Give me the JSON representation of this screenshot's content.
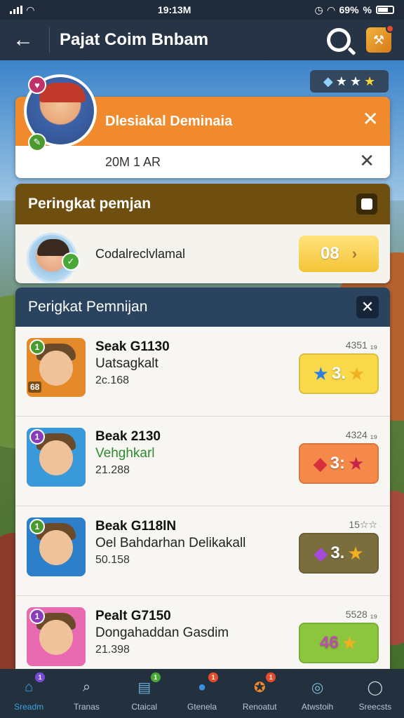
{
  "status_bar": {
    "time": "19:13M",
    "battery": "69%",
    "extra": "%"
  },
  "app_bar": {
    "back_icon": "arrow-left-icon",
    "title": "Pajat Coim Bnbam",
    "search_icon": "search-icon",
    "app_icon": "game-app-icon"
  },
  "rating": {
    "stars_filled": 3,
    "icons": [
      "gem-icon",
      "star-icon",
      "star-icon",
      "star-icon"
    ]
  },
  "notification": {
    "title": "Dlesiakal Deminaia",
    "subtitle": "20M 1 AR"
  },
  "ranking_card": {
    "header": "Peringkat pemjan",
    "name": "Codalreclvlamal",
    "button_value": "08"
  },
  "list_panel": {
    "header": "Perigkat Pemnijan",
    "items": [
      {
        "title": "Seak G1130",
        "subtitle": "Uatsagkalt",
        "value": "2c.168",
        "meta": "4351 ₁₉",
        "badge_num": "1",
        "thumb_level": "68",
        "button_text": "3.",
        "button_icons": [
          "blue-star-icon",
          "gold-star-icon"
        ],
        "button_color": "#f9d94a",
        "thumb_color": "#e58a2a",
        "badge_color": "#4a9a2e",
        "subtitle_green": false
      },
      {
        "title": "Beak 2130",
        "subtitle": "Vehghkarl",
        "value": "21.288",
        "meta": "4324 ₁₉",
        "badge_num": "1",
        "thumb_level": "",
        "button_text": "3:",
        "button_icons": [
          "red-gem-icon",
          "red-star-icon"
        ],
        "button_color": "#f4894a",
        "thumb_color": "#3a9ad9",
        "badge_color": "#8a3db8",
        "subtitle_green": true
      },
      {
        "title": "Beak G118lN",
        "subtitle": "Oel Bahdarhan Delikakall",
        "value": "50.158",
        "meta": "15☆☆",
        "badge_num": "1",
        "thumb_level": "",
        "button_text": "3.",
        "button_icons": [
          "purple-gem-icon",
          "gold-star-icon"
        ],
        "button_color": "#7a6d3e",
        "thumb_color": "#2e7fc9",
        "badge_color": "#4a9a2e",
        "subtitle_green": false
      },
      {
        "title": "Pealt G7150",
        "subtitle": "Dongahaddan Gasdim",
        "value": "21.398",
        "meta": "5528 ₁₉",
        "badge_num": "1",
        "thumb_level": "",
        "button_text": "46",
        "button_icons": [
          "gold-star-icon"
        ],
        "button_color": "#8cc63f",
        "thumb_color": "#e86ab0",
        "badge_color": "#8a3db8",
        "subtitle_green": false
      }
    ]
  },
  "bottom_nav": [
    {
      "label": "Sreadm",
      "icon": "home-icon",
      "active": true,
      "badge": "1"
    },
    {
      "label": "Tranas",
      "icon": "search-icon",
      "active": false,
      "badge": ""
    },
    {
      "label": "Ctaical",
      "icon": "tasks-icon",
      "active": false,
      "badge": "1"
    },
    {
      "label": "Gtenela",
      "icon": "chat-icon",
      "active": false,
      "badge": "1"
    },
    {
      "label": "Renoatut",
      "icon": "trophy-icon",
      "active": false,
      "badge": "1"
    },
    {
      "label": "Atwstoih",
      "icon": "globe-icon",
      "active": false,
      "badge": ""
    },
    {
      "label": "Sreecsts",
      "icon": "profile-icon",
      "active": false,
      "badge": ""
    }
  ]
}
